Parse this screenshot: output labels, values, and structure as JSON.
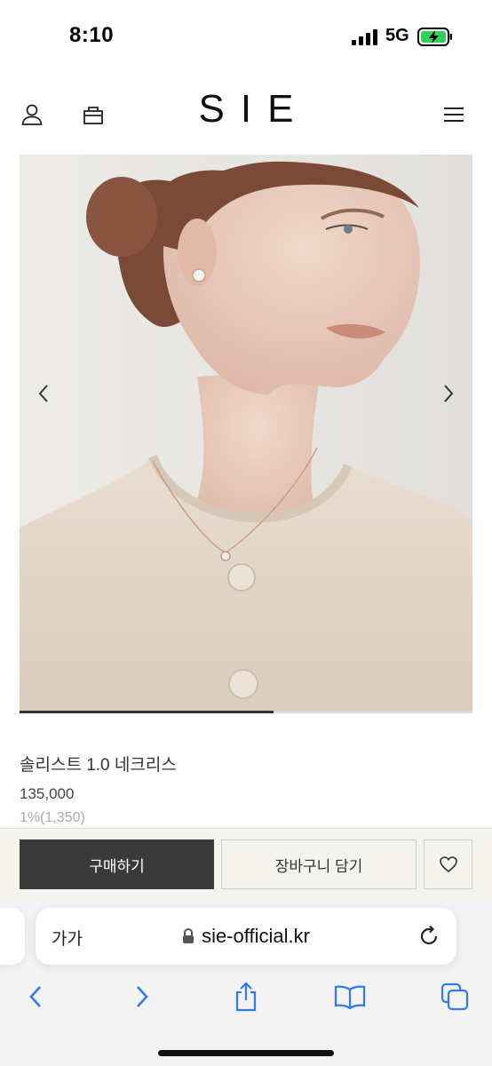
{
  "status_bar": {
    "time": "8:10",
    "network": "5G"
  },
  "header": {
    "logo": "SIE",
    "icons": [
      "account-icon",
      "shopping-bag-icon",
      "menu-icon"
    ]
  },
  "hero": {
    "slide_progress": 0.56,
    "icons": [
      "chevron-left-icon",
      "chevron-right-icon"
    ]
  },
  "product": {
    "name": "솔리스트 1.0 네크리스",
    "price": "135,000",
    "points": "1%(1,350)"
  },
  "actions": {
    "buy_label": "구매하기",
    "cart_label": "장바구니 담기",
    "wish_icon": "heart-icon"
  },
  "browser": {
    "text_size_label": "가가",
    "url": "sie-official.kr",
    "toolbar_icons": [
      "back-icon",
      "forward-icon",
      "share-icon",
      "bookmarks-icon",
      "tabs-icon"
    ]
  },
  "colors": {
    "buy_button": "#3a3a3a",
    "action_bar_bg": "#f4f3ee",
    "safari_blue": "#2f7bf6",
    "battery_green": "#30d158"
  }
}
